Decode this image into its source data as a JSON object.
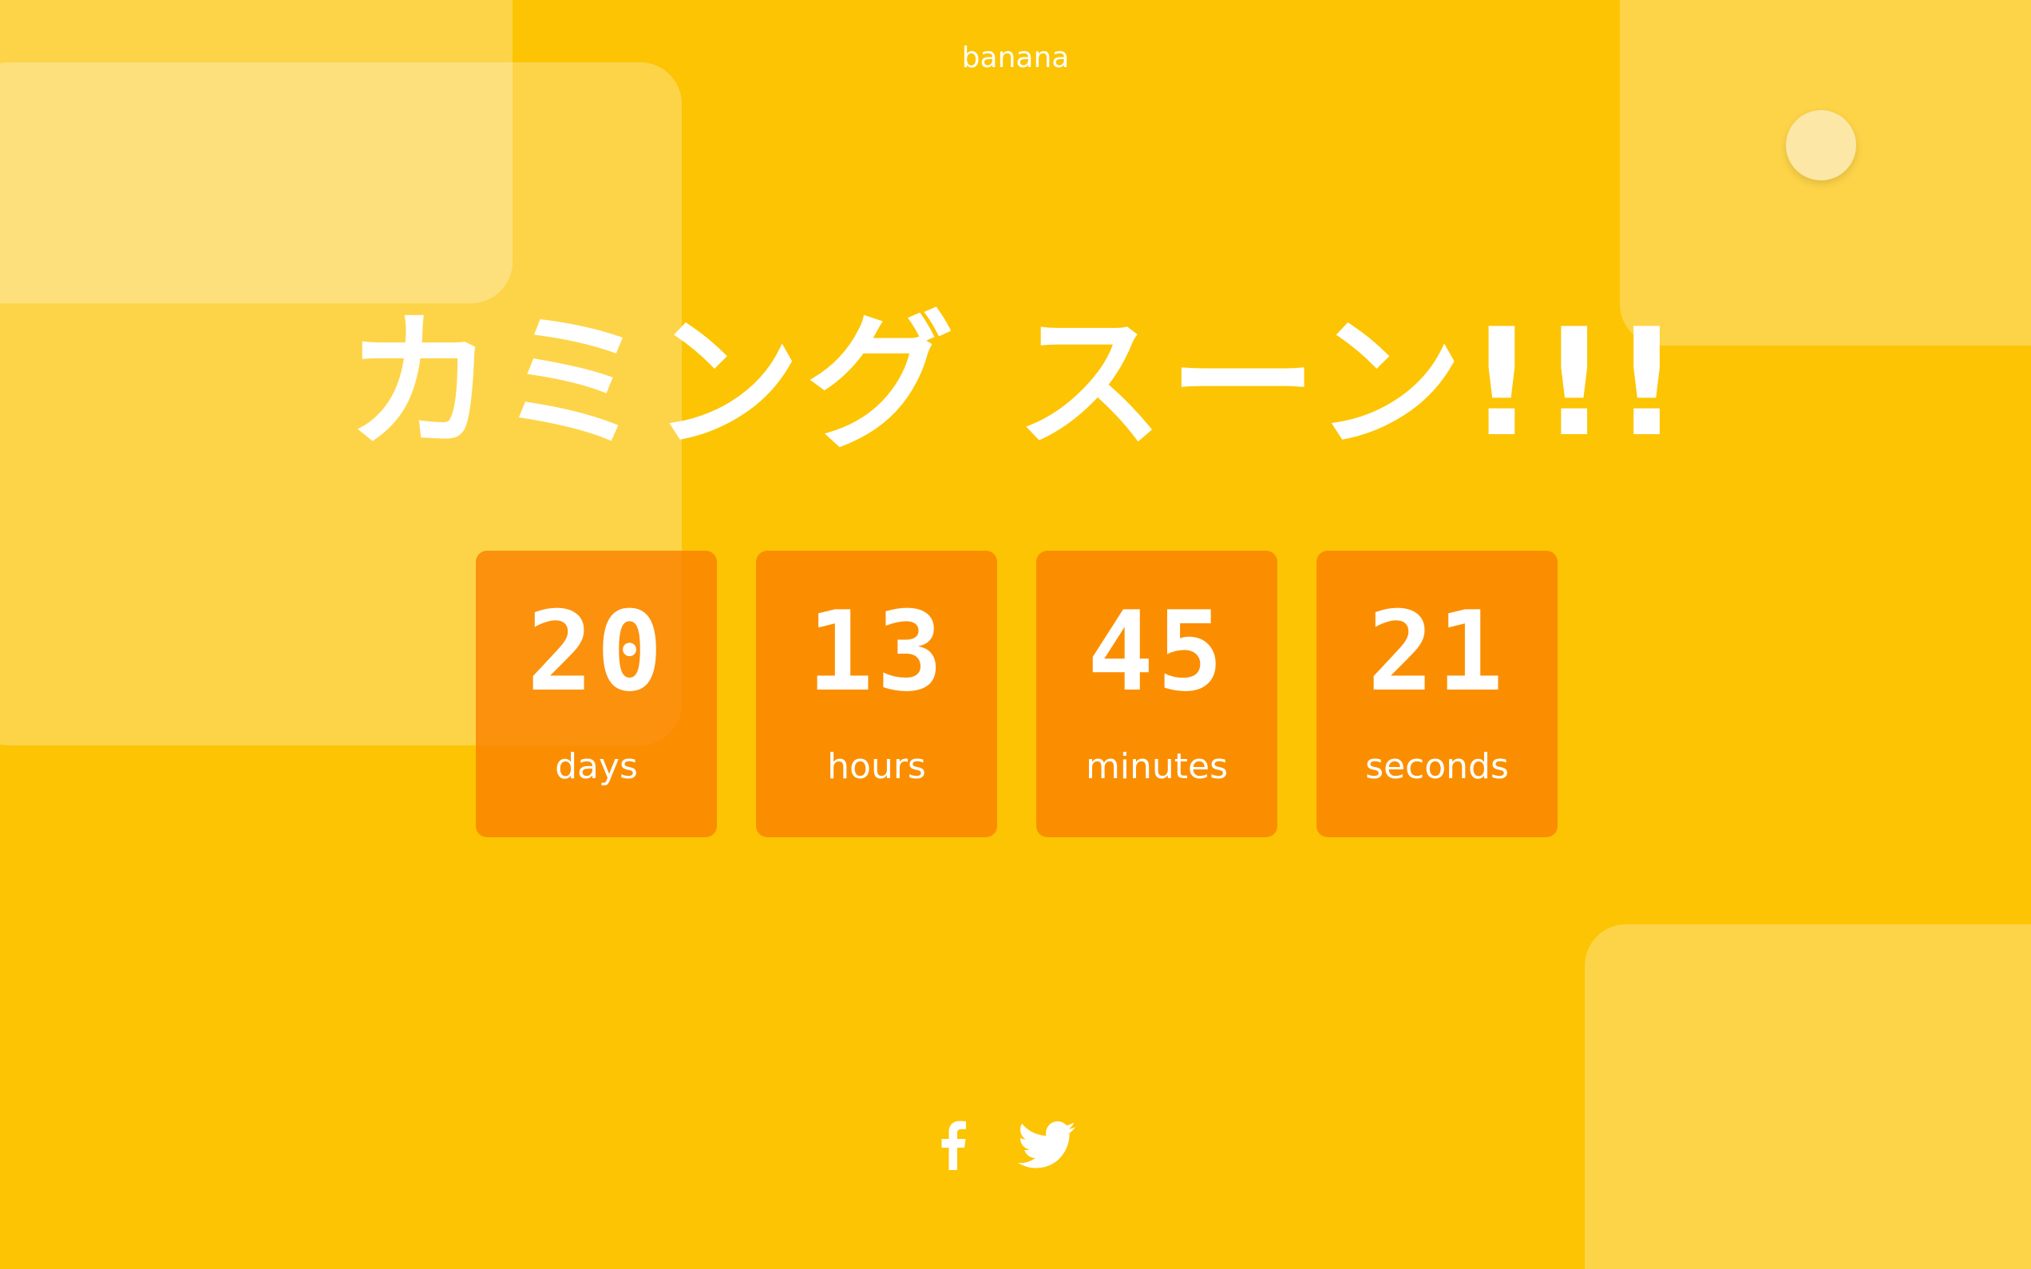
{
  "brand": "banana",
  "headline": "カミング スーン!!!",
  "countdown": [
    {
      "value": "20",
      "unit": "days"
    },
    {
      "value": "13",
      "unit": "hours"
    },
    {
      "value": "45",
      "unit": "minutes"
    },
    {
      "value": "21",
      "unit": "seconds"
    }
  ],
  "social": [
    {
      "icon": "facebook-icon"
    },
    {
      "icon": "twitter-icon"
    }
  ],
  "colors": {
    "background": "#fcc402",
    "countdown_tile": "#fa8200",
    "text": "#ffffff"
  }
}
